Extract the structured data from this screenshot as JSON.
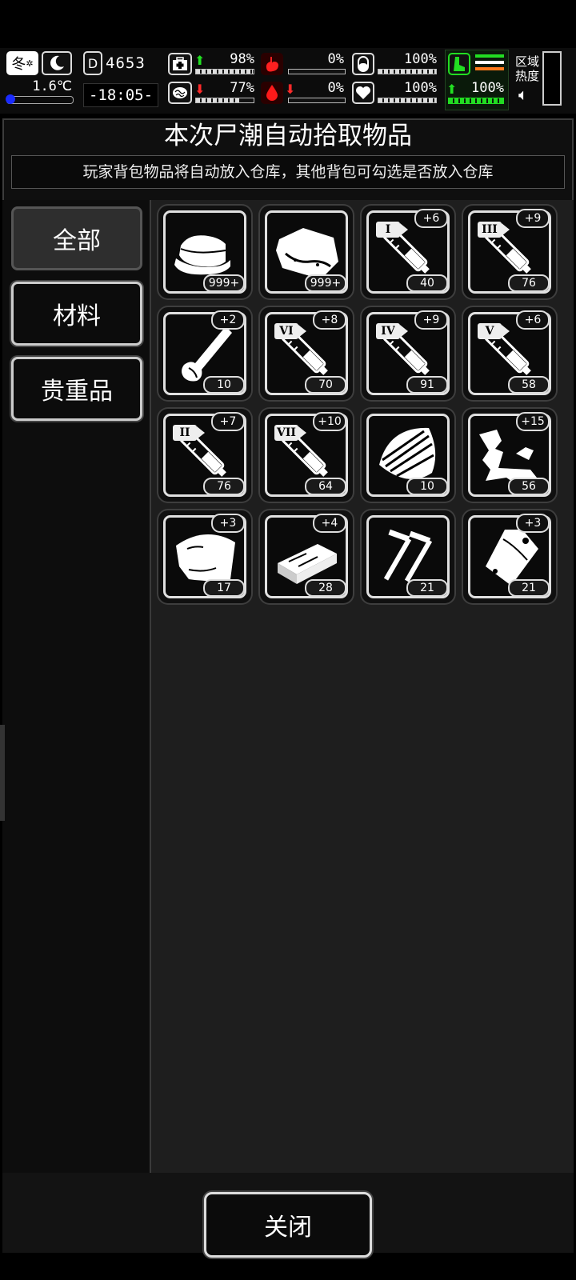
{
  "status": {
    "season": "冬",
    "temperature": "1.6℃",
    "day_counter": "4653",
    "time": "-18:05-",
    "health_pct": "98%",
    "sanity_pct": "77%",
    "hunger_pct": "0%",
    "thirst_pct": "0%",
    "energy_pct": "100%",
    "heart_pct": "100%",
    "stamina_pct": "100%",
    "zone_heat_label_1": "区域",
    "zone_heat_label_2": "热度"
  },
  "dialog": {
    "title": "本次尸潮自动拾取物品",
    "notice": "玩家背包物品将自动放入仓库，其他背包可勾选是否放入仓库"
  },
  "tabs": [
    {
      "label": "全部"
    },
    {
      "label": "材料"
    },
    {
      "label": "贵重品"
    }
  ],
  "items": [
    {
      "icon": "cloth-icon",
      "count": "999+"
    },
    {
      "icon": "meat-icon",
      "count": "999+"
    },
    {
      "icon": "syringe-icon",
      "roman": "I",
      "plus": "+6",
      "count": "40"
    },
    {
      "icon": "syringe-icon",
      "roman": "III",
      "plus": "+9",
      "count": "76"
    },
    {
      "icon": "bone-icon",
      "plus": "+2",
      "count": "10"
    },
    {
      "icon": "syringe-icon",
      "roman": "VI",
      "plus": "+8",
      "count": "70"
    },
    {
      "icon": "syringe-icon",
      "roman": "IV",
      "plus": "+9",
      "count": "91"
    },
    {
      "icon": "syringe-icon",
      "roman": "V",
      "plus": "+6",
      "count": "58"
    },
    {
      "icon": "syringe-icon",
      "roman": "II",
      "plus": "+7",
      "count": "76"
    },
    {
      "icon": "syringe-icon",
      "roman": "VII",
      "plus": "+10",
      "count": "64"
    },
    {
      "icon": "wood-pile-icon",
      "count": "10"
    },
    {
      "icon": "scrap-icon",
      "plus": "+15",
      "count": "56"
    },
    {
      "icon": "leather-icon",
      "plus": "+3",
      "count": "17"
    },
    {
      "icon": "wood-plank-icon",
      "plus": "+4",
      "count": "28"
    },
    {
      "icon": "nails-icon",
      "count": "21"
    },
    {
      "icon": "plastic-bag-icon",
      "plus": "+3",
      "count": "21"
    }
  ],
  "footer": {
    "close_label": "关闭"
  }
}
